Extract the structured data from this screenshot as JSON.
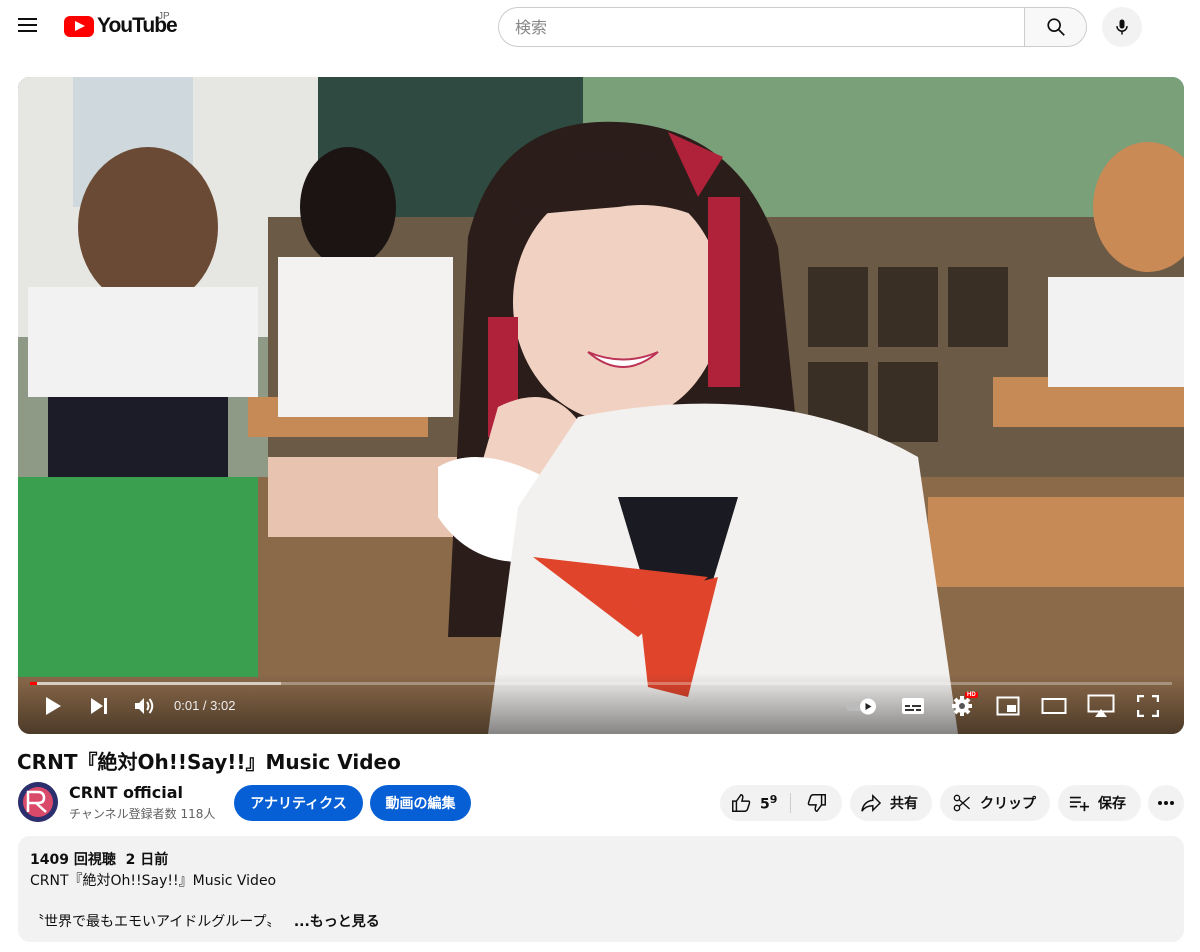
{
  "header": {
    "logo_text": "YouTube",
    "country_code": "JP",
    "search_placeholder": "検索"
  },
  "player": {
    "current_time": "0:01",
    "duration": "3:02",
    "time_separator": " / ",
    "played_fraction": 0.006,
    "loaded_fraction": 0.22,
    "hd_badge": "HD"
  },
  "video": {
    "title": "CRNT『絶対Oh!!Say!!』Music Video",
    "channel_name": "CRNT official",
    "subscribers": "チャンネル登録者数 118人",
    "analytics_label": "アナリティクス",
    "edit_label": "動画の編集",
    "like_count": "59",
    "share_label": "共有",
    "clip_label": "クリップ",
    "save_label": "保存"
  },
  "description": {
    "views": "1409 回視聴",
    "date": "2 日前",
    "line1": "CRNT『絶対Oh!!Say!!』Music Video",
    "line2": "〝世界で最もエモいアイドルグループ〟",
    "more": "...もっと見る"
  },
  "colors": {
    "brand_red": "#ff0000",
    "accent_blue": "#065fd4",
    "chip_bg": "#f2f2f2"
  },
  "icons": [
    "menu-icon",
    "search-icon",
    "mic-icon",
    "play-icon",
    "next-icon",
    "volume-icon",
    "autoplay-toggle-icon",
    "subtitles-icon",
    "settings-icon",
    "miniplayer-icon",
    "theater-icon",
    "cast-icon",
    "fullscreen-icon",
    "like-icon",
    "dislike-icon",
    "share-icon",
    "scissors-icon",
    "playlist-add-icon",
    "more-icon"
  ]
}
